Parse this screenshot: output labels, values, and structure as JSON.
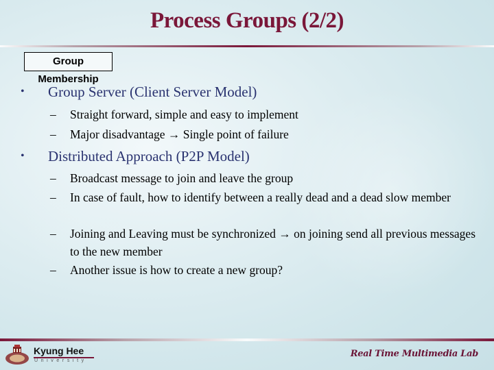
{
  "slide": {
    "title": "Process Groups (2/2)",
    "section_label": "Group Membership",
    "bullets": [
      {
        "text": "Group Server (Client Server Model)",
        "sub": [
          "Straight forward, simple and easy to implement",
          "Major disadvantage → Single point of failure"
        ]
      },
      {
        "text": "Distributed Approach (P2P Model)",
        "sub": [
          "Broadcast message to join and leave the group",
          "In case of fault, how to identify between a really dead and a dead slow member",
          "Joining and Leaving must be synchronized → on joining send all previous messages to the new member",
          "Another issue is how to create a new group?"
        ]
      }
    ],
    "bullet_glyph": "•",
    "dash_glyph": "–"
  },
  "footer": {
    "university_name": "Kyung Hee",
    "university_sub": "University",
    "lab_name": "Real Time Multimedia Lab"
  },
  "colors": {
    "title": "#7a1739",
    "level1_text": "#2a3370",
    "level2_text": "#000000"
  }
}
